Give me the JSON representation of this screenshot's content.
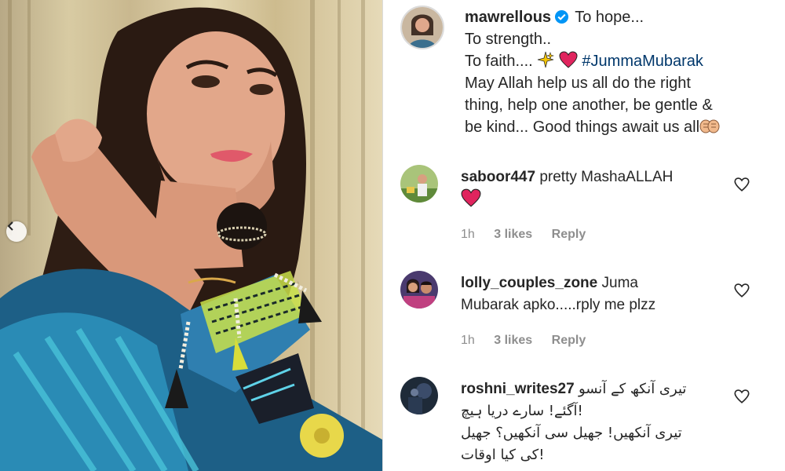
{
  "post": {
    "username": "mawrellous",
    "caption_lines": [
      "To hope...",
      "To strength..",
      "To faith....",
      "May Allah help us all do the right",
      "thing, help one another, be gentle &",
      "be kind... Good things await us all"
    ],
    "hashtag": "#JummaMubarak",
    "icons": {
      "sparkle": "sparkles-icon",
      "heart": "red-heart-icon",
      "hands": "praying-hands-icon",
      "verified": "verified-badge-icon"
    }
  },
  "comments": [
    {
      "username": "saboor447",
      "text": "pretty MashaALLAH",
      "time": "1h",
      "likes": "3 likes",
      "reply": "Reply"
    },
    {
      "username": "lolly_couples_zone",
      "text_line1": "Juma",
      "text_line2": "Mubarak apko.....rply me plzz",
      "time": "1h",
      "likes": "3 likes",
      "reply": "Reply"
    },
    {
      "username": "roshni_writes27",
      "urdu_lines": [
        "تیری آنکھ کے آنسو",
        "!آگئے! سارے دریا ہیچ",
        "تیری آنکھیں! جھیل سی آنکھیں؟ جھیل",
        "!کی کیا اوقات"
      ]
    }
  ],
  "colors": {
    "accent_blue": "#0095f6",
    "heart_red": "#ed4956",
    "meta_gray": "#8e8e8e",
    "text": "#262626"
  }
}
